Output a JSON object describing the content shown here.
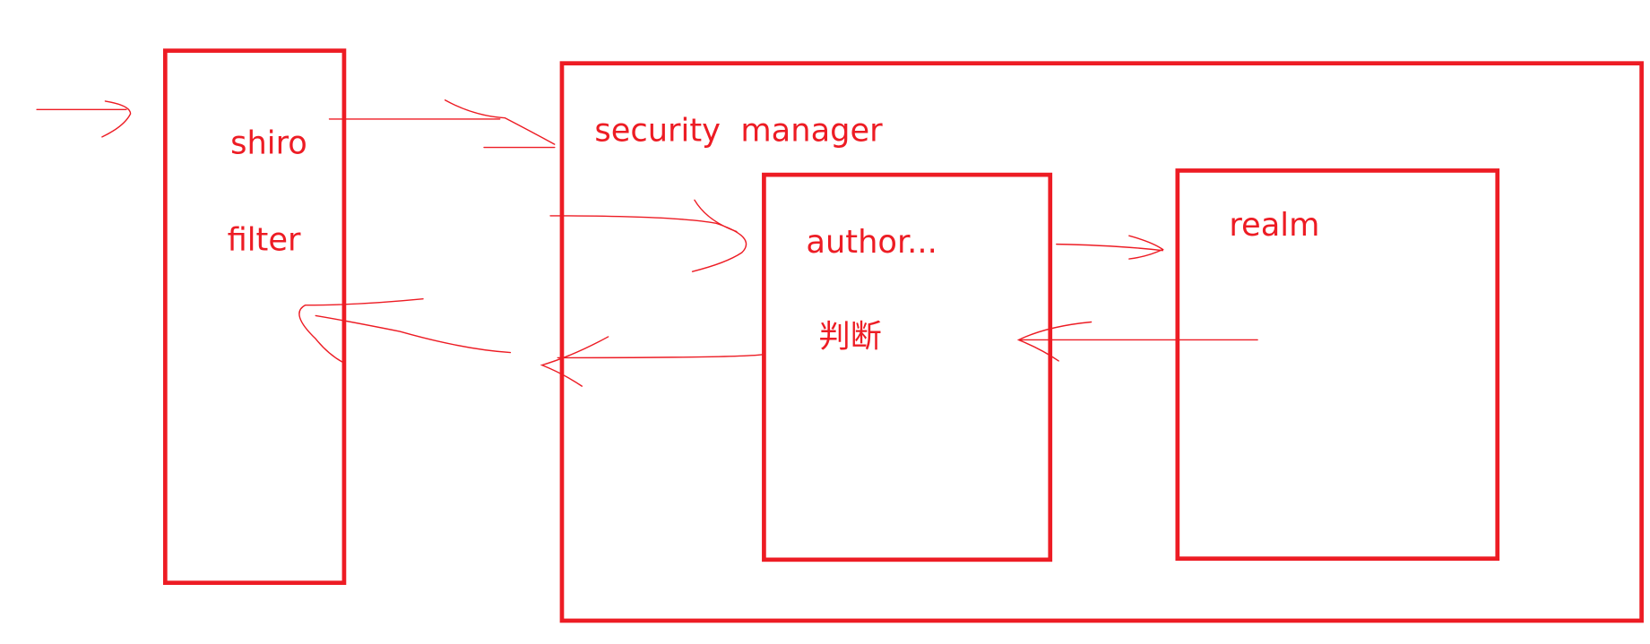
{
  "colors": {
    "ink": "#ed1c24",
    "background": "#ffffff"
  },
  "shiro_filter": {
    "line1": "shiro",
    "line2": "filter"
  },
  "security_manager": {
    "title": "security  manager"
  },
  "authorizer": {
    "title": "author...",
    "note": "判断"
  },
  "realm": {
    "title": "realm"
  }
}
